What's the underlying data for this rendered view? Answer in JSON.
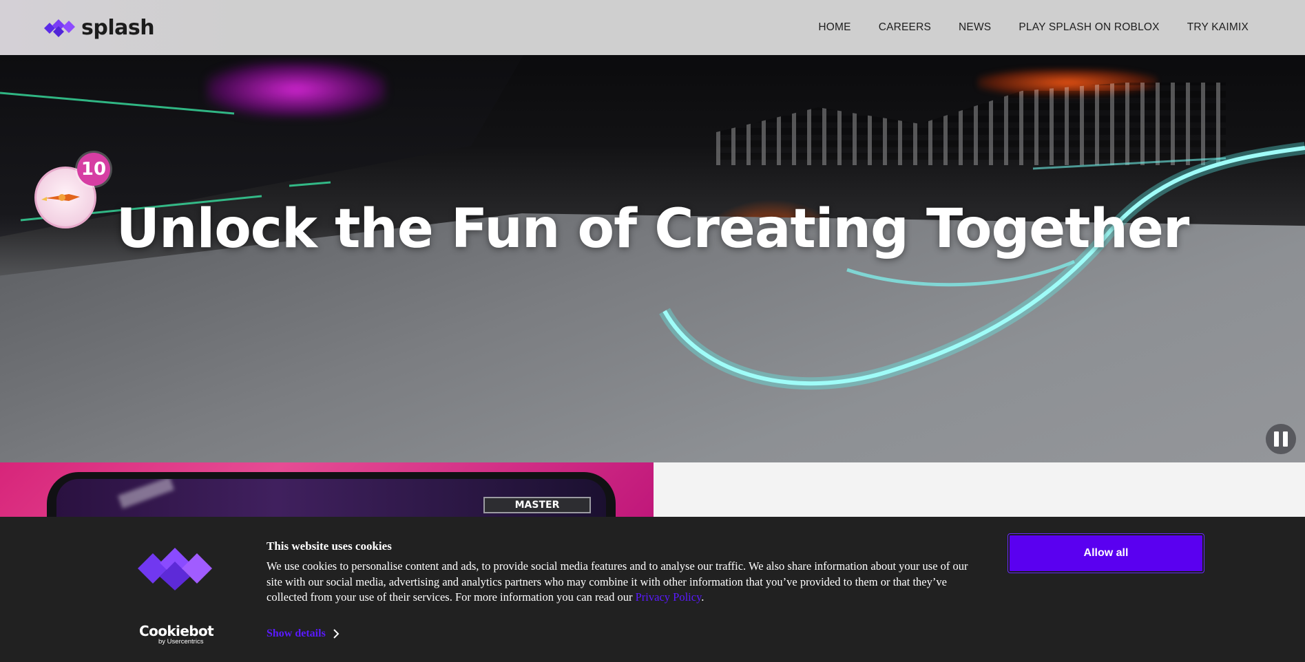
{
  "header": {
    "logo_text": "splash",
    "nav": [
      {
        "label": "HOME"
      },
      {
        "label": "CAREERS"
      },
      {
        "label": "NEWS"
      },
      {
        "label": "PLAY SPLASH ON ROBLOX"
      },
      {
        "label": "TRY KAIMIX"
      }
    ]
  },
  "hero": {
    "title": "Unlock the Fun of Creating Together",
    "badge_count": "10",
    "pause_icon": "pause-icon"
  },
  "promo": {
    "tag_text": "MASTER"
  },
  "cookie_banner": {
    "title": "This website uses cookies",
    "text_before_link": "We use cookies to personalise content and ads, to provide social media features and to analyse our traffic. We also share information about your use of our site with our social media, advertising and analytics partners who may combine it with other information that you’ve provided to them or that they’ve collected from your use of their services. For more information you can read our ",
    "privacy_link": "Privacy Policy",
    "text_after_link": ".",
    "show_details": "Show details",
    "allow_all": "Allow all",
    "brand_name": "Cookiebot",
    "brand_sub": "by Usercentrics"
  },
  "colors": {
    "accent": "#5a00f0",
    "link": "#5a1aff",
    "banner_bg": "#212121",
    "logo_purple": "#6d2cf2"
  }
}
